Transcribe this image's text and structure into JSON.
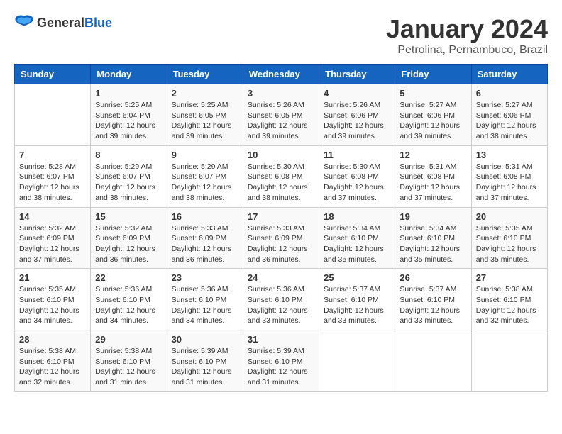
{
  "header": {
    "logo_general": "General",
    "logo_blue": "Blue",
    "month_title": "January 2024",
    "location": "Petrolina, Pernambuco, Brazil"
  },
  "weekdays": [
    "Sunday",
    "Monday",
    "Tuesday",
    "Wednesday",
    "Thursday",
    "Friday",
    "Saturday"
  ],
  "weeks": [
    [
      {
        "day": "",
        "info": ""
      },
      {
        "day": "1",
        "info": "Sunrise: 5:25 AM\nSunset: 6:04 PM\nDaylight: 12 hours\nand 39 minutes."
      },
      {
        "day": "2",
        "info": "Sunrise: 5:25 AM\nSunset: 6:05 PM\nDaylight: 12 hours\nand 39 minutes."
      },
      {
        "day": "3",
        "info": "Sunrise: 5:26 AM\nSunset: 6:05 PM\nDaylight: 12 hours\nand 39 minutes."
      },
      {
        "day": "4",
        "info": "Sunrise: 5:26 AM\nSunset: 6:06 PM\nDaylight: 12 hours\nand 39 minutes."
      },
      {
        "day": "5",
        "info": "Sunrise: 5:27 AM\nSunset: 6:06 PM\nDaylight: 12 hours\nand 39 minutes."
      },
      {
        "day": "6",
        "info": "Sunrise: 5:27 AM\nSunset: 6:06 PM\nDaylight: 12 hours\nand 38 minutes."
      }
    ],
    [
      {
        "day": "7",
        "info": "Sunrise: 5:28 AM\nSunset: 6:07 PM\nDaylight: 12 hours\nand 38 minutes."
      },
      {
        "day": "8",
        "info": "Sunrise: 5:29 AM\nSunset: 6:07 PM\nDaylight: 12 hours\nand 38 minutes."
      },
      {
        "day": "9",
        "info": "Sunrise: 5:29 AM\nSunset: 6:07 PM\nDaylight: 12 hours\nand 38 minutes."
      },
      {
        "day": "10",
        "info": "Sunrise: 5:30 AM\nSunset: 6:08 PM\nDaylight: 12 hours\nand 38 minutes."
      },
      {
        "day": "11",
        "info": "Sunrise: 5:30 AM\nSunset: 6:08 PM\nDaylight: 12 hours\nand 37 minutes."
      },
      {
        "day": "12",
        "info": "Sunrise: 5:31 AM\nSunset: 6:08 PM\nDaylight: 12 hours\nand 37 minutes."
      },
      {
        "day": "13",
        "info": "Sunrise: 5:31 AM\nSunset: 6:08 PM\nDaylight: 12 hours\nand 37 minutes."
      }
    ],
    [
      {
        "day": "14",
        "info": "Sunrise: 5:32 AM\nSunset: 6:09 PM\nDaylight: 12 hours\nand 37 minutes."
      },
      {
        "day": "15",
        "info": "Sunrise: 5:32 AM\nSunset: 6:09 PM\nDaylight: 12 hours\nand 36 minutes."
      },
      {
        "day": "16",
        "info": "Sunrise: 5:33 AM\nSunset: 6:09 PM\nDaylight: 12 hours\nand 36 minutes."
      },
      {
        "day": "17",
        "info": "Sunrise: 5:33 AM\nSunset: 6:09 PM\nDaylight: 12 hours\nand 36 minutes."
      },
      {
        "day": "18",
        "info": "Sunrise: 5:34 AM\nSunset: 6:10 PM\nDaylight: 12 hours\nand 35 minutes."
      },
      {
        "day": "19",
        "info": "Sunrise: 5:34 AM\nSunset: 6:10 PM\nDaylight: 12 hours\nand 35 minutes."
      },
      {
        "day": "20",
        "info": "Sunrise: 5:35 AM\nSunset: 6:10 PM\nDaylight: 12 hours\nand 35 minutes."
      }
    ],
    [
      {
        "day": "21",
        "info": "Sunrise: 5:35 AM\nSunset: 6:10 PM\nDaylight: 12 hours\nand 34 minutes."
      },
      {
        "day": "22",
        "info": "Sunrise: 5:36 AM\nSunset: 6:10 PM\nDaylight: 12 hours\nand 34 minutes."
      },
      {
        "day": "23",
        "info": "Sunrise: 5:36 AM\nSunset: 6:10 PM\nDaylight: 12 hours\nand 34 minutes."
      },
      {
        "day": "24",
        "info": "Sunrise: 5:36 AM\nSunset: 6:10 PM\nDaylight: 12 hours\nand 33 minutes."
      },
      {
        "day": "25",
        "info": "Sunrise: 5:37 AM\nSunset: 6:10 PM\nDaylight: 12 hours\nand 33 minutes."
      },
      {
        "day": "26",
        "info": "Sunrise: 5:37 AM\nSunset: 6:10 PM\nDaylight: 12 hours\nand 33 minutes."
      },
      {
        "day": "27",
        "info": "Sunrise: 5:38 AM\nSunset: 6:10 PM\nDaylight: 12 hours\nand 32 minutes."
      }
    ],
    [
      {
        "day": "28",
        "info": "Sunrise: 5:38 AM\nSunset: 6:10 PM\nDaylight: 12 hours\nand 32 minutes."
      },
      {
        "day": "29",
        "info": "Sunrise: 5:38 AM\nSunset: 6:10 PM\nDaylight: 12 hours\nand 31 minutes."
      },
      {
        "day": "30",
        "info": "Sunrise: 5:39 AM\nSunset: 6:10 PM\nDaylight: 12 hours\nand 31 minutes."
      },
      {
        "day": "31",
        "info": "Sunrise: 5:39 AM\nSunset: 6:10 PM\nDaylight: 12 hours\nand 31 minutes."
      },
      {
        "day": "",
        "info": ""
      },
      {
        "day": "",
        "info": ""
      },
      {
        "day": "",
        "info": ""
      }
    ]
  ]
}
